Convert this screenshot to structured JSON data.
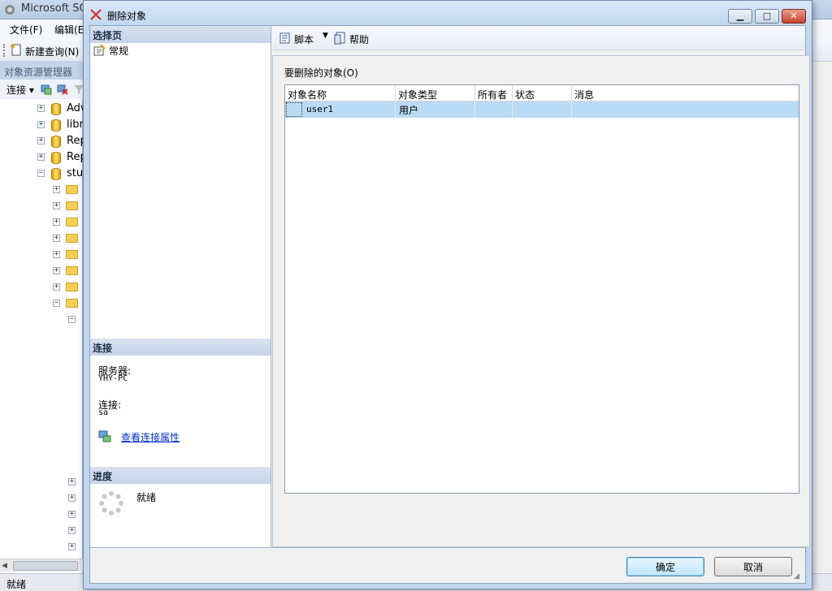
{
  "background_app": {
    "title": "Microsoft SQ",
    "menu": [
      "文件(F)",
      "编辑(E"
    ],
    "toolbar": {
      "new_query": "新建查询(N)"
    },
    "object_explorer": {
      "header": "对象资源管理器",
      "connect": "连接 ▾",
      "tree_db_labels": [
        "Adv",
        "libr",
        "Rep",
        "Rep",
        "stu"
      ],
      "status": "就绪"
    }
  },
  "dialog": {
    "title": "删除对象",
    "window_buttons": {
      "minimize": "▁",
      "maximize": "□",
      "close": "✕"
    },
    "left_pane": {
      "select_page_header": "选择页",
      "pages": [
        {
          "label": "常规",
          "icon": "page-settings-icon"
        }
      ],
      "connection_header": "连接",
      "server_label": "服务器:",
      "server_value": "YHY-PC",
      "connection_label": "连接:",
      "connection_value": "sa",
      "view_connection_props": "查看连接属性",
      "progress_header": "进度",
      "progress_status": "就绪"
    },
    "toolbar": {
      "script_label": "脚本",
      "script_dropdown_arrow": "▼",
      "help_label": "帮助"
    },
    "objects_label": "要删除的对象(O)",
    "grid": {
      "columns": [
        "对象名称",
        "对象类型",
        "所有者",
        "状态",
        "消息"
      ],
      "rows": [
        {
          "name": "user1",
          "type": "用户",
          "owner": "",
          "status": "",
          "message": ""
        }
      ]
    },
    "buttons": {
      "ok": "确定",
      "cancel": "取消"
    },
    "colors": {
      "selected_row": "#b8dcf5",
      "link": "#0033cc",
      "section_header": "#c6d5e7"
    }
  }
}
